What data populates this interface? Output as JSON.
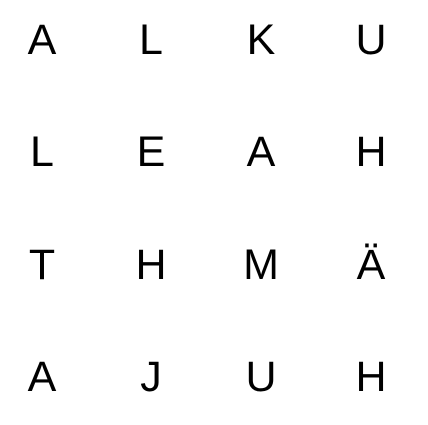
{
  "grid": {
    "rows": [
      [
        "A",
        "L",
        "K",
        "U"
      ],
      [
        "L",
        "E",
        "A",
        "H"
      ],
      [
        "T",
        "H",
        "M",
        "Ä"
      ],
      [
        "A",
        "J",
        "U",
        "H"
      ]
    ]
  },
  "colors": {
    "background": "#ffffff",
    "letter": "#000000"
  }
}
